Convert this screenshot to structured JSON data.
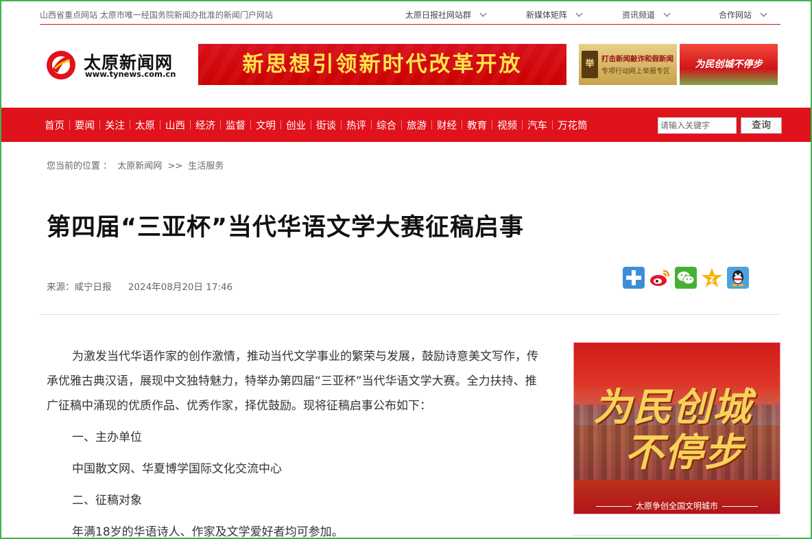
{
  "topbar": {
    "tagline": "山西省重点网站 太原市唯一经国务院新闻办批准的新闻门户网站",
    "links": [
      "太原日报社网站群",
      "新媒体矩阵",
      "资讯频道",
      "合作网站"
    ]
  },
  "logo": {
    "name": "太原新闻网",
    "url": "www.tynews.com.cn"
  },
  "banners": {
    "main": "新思想引领新时代改革开放",
    "small1_line1": "打击新闻敲诈和假新闻",
    "small1_line2": "专项行动网上举报专区",
    "small2": "为民创城不停步"
  },
  "nav": {
    "items": [
      "首页",
      "要闻",
      "关注",
      "太原",
      "山西",
      "经济",
      "监督",
      "文明",
      "创业",
      "街谈",
      "热评",
      "综合",
      "旅游",
      "财经",
      "教育",
      "视频",
      "汽车",
      "万花筒"
    ],
    "search_placeholder": "请输入关键字",
    "search_button": "查询"
  },
  "breadcrumb": {
    "prefix": "您当前的位置 ：",
    "home": "太原新闻网",
    "sep": ">>",
    "section": "生活服务"
  },
  "article": {
    "title": "第四届“三亚杯”当代华语文学大赛征稿启事",
    "source": "来源：咸宁日报",
    "date": "2024年08月20日 17:46",
    "paragraphs": [
      "为激发当代华语作家的创作激情，推动当代文学事业的繁荣与发展，鼓励诗意美文写作，传承优雅古典汉语，展现中文独特魅力，特举办第四届“三亚杯”当代华语文学大赛。全力扶持、推广征稿中涌现的优质作品、优秀作家，择优鼓励。现将征稿启事公布如下：",
      "一、主办单位",
      "中国散文网、华夏博学国际文化交流中心",
      "二、征稿对象",
      "年满18岁的华语诗人、作家及文学爱好者均可参加。"
    ]
  },
  "share": [
    "plus-share-icon",
    "weibo-icon",
    "wechat-icon",
    "favorite-icon",
    "qq-icon"
  ],
  "side_ad": {
    "line1": "为民创城",
    "line2": "不停步",
    "caption": "太原争创全国文明城市"
  },
  "colors": {
    "brand_red": "#e0121c",
    "frame_green": "#3fb34f"
  }
}
